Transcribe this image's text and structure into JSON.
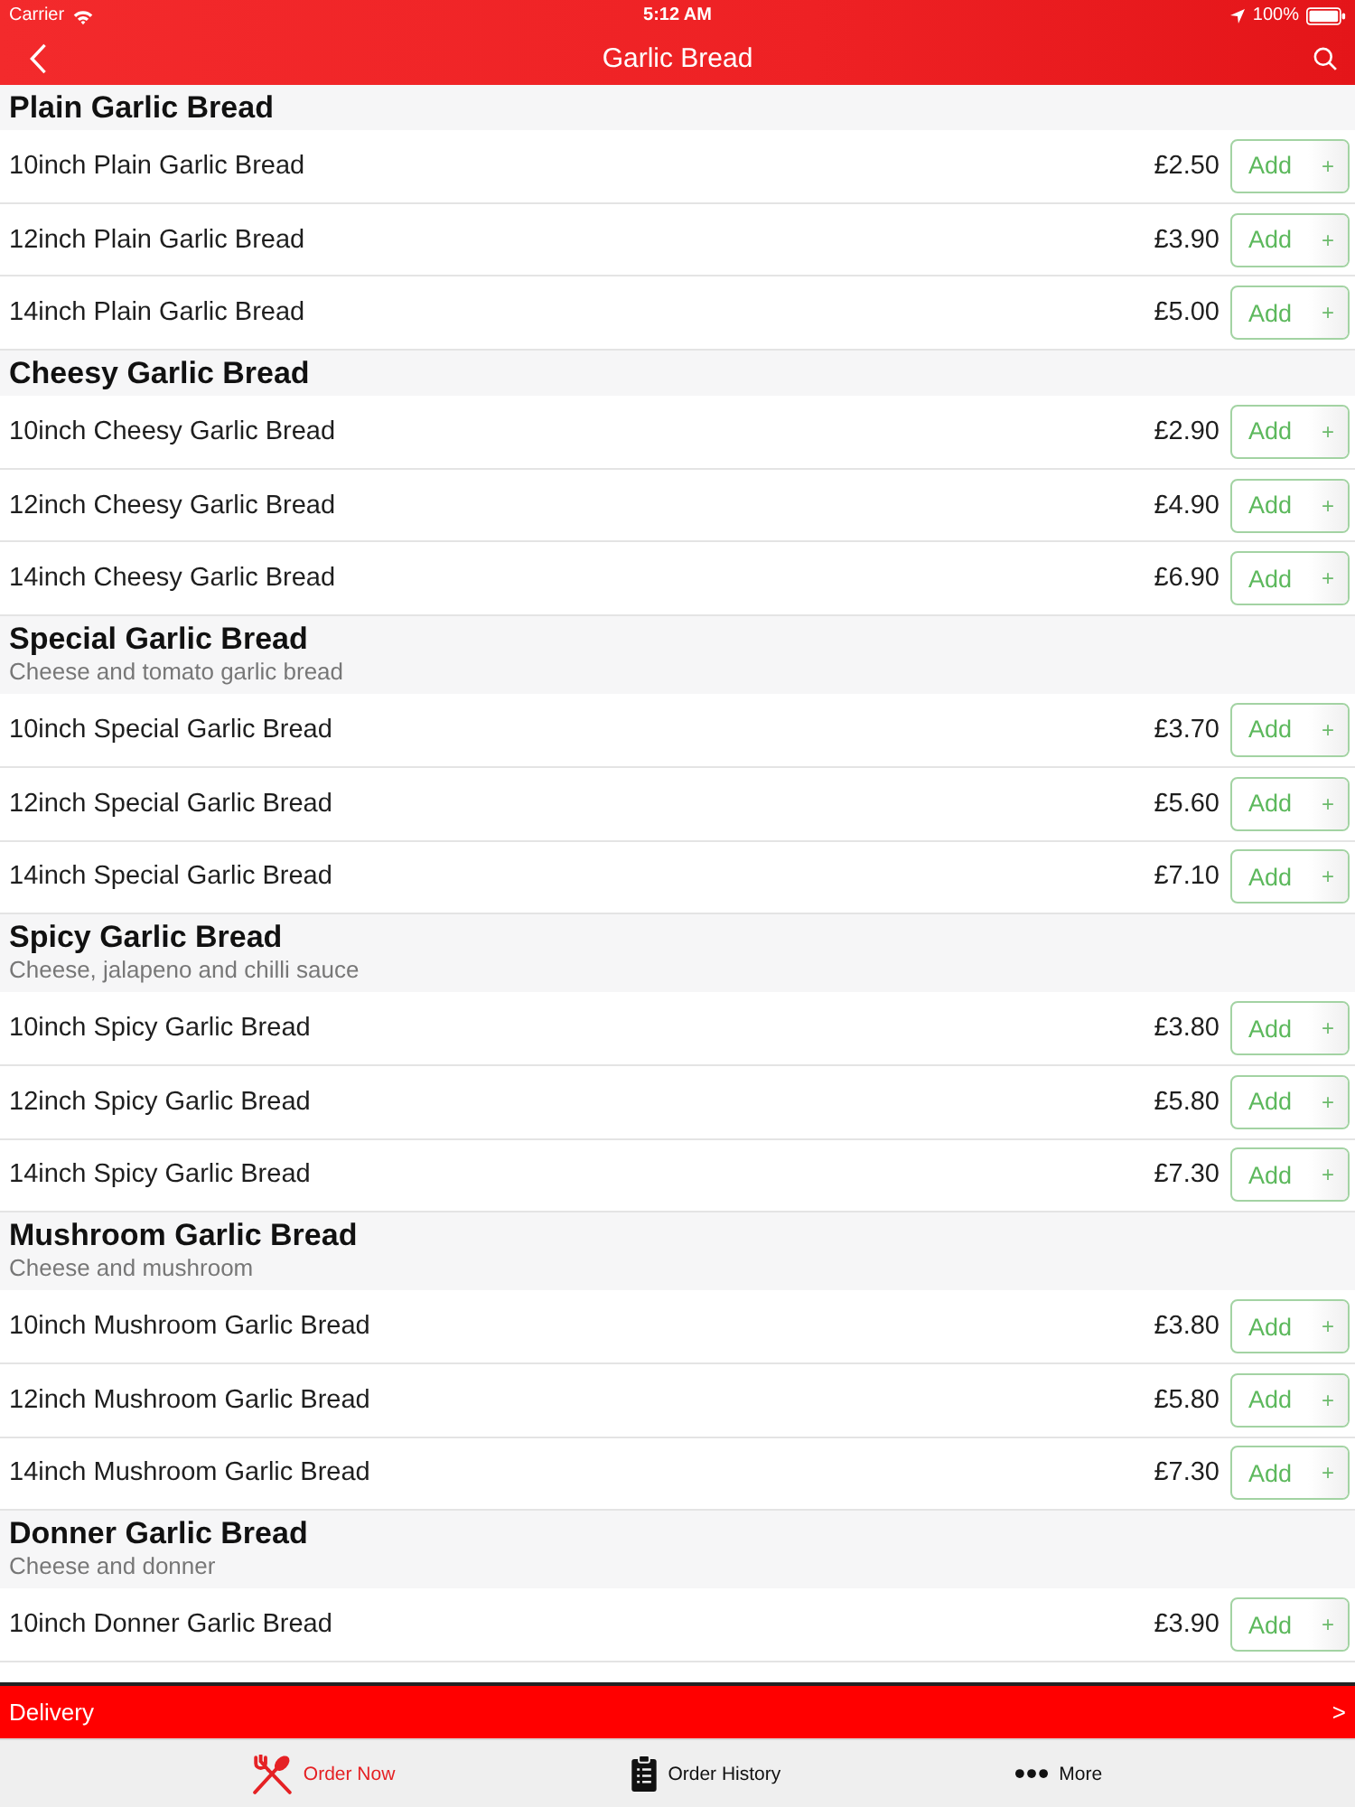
{
  "status_bar": {
    "carrier": "Carrier",
    "time": "5:12 AM",
    "battery": "100%"
  },
  "nav": {
    "title": "Garlic Bread"
  },
  "sections": [
    {
      "title": "Plain Garlic Bread",
      "items": [
        {
          "name": "10inch Plain Garlic Bread",
          "price": "£2.50",
          "button": "Add",
          "button_icon": "+"
        },
        {
          "name": "12inch Plain Garlic Bread",
          "price": "£3.90",
          "button": "Add",
          "button_icon": "+"
        },
        {
          "name": "14inch Plain Garlic Bread",
          "price": "£5.00",
          "button": "Add",
          "button_icon": "+"
        }
      ]
    },
    {
      "title": "Cheesy Garlic Bread",
      "items": [
        {
          "name": "10inch Cheesy Garlic Bread",
          "price": "£2.90",
          "button": "Add",
          "button_icon": "+"
        },
        {
          "name": "12inch Cheesy Garlic Bread",
          "price": "£4.90",
          "button": "Add",
          "button_icon": "+"
        },
        {
          "name": "14inch Cheesy Garlic Bread",
          "price": "£6.90",
          "button": "Add",
          "button_icon": "+"
        }
      ]
    },
    {
      "title": "Special Garlic Bread",
      "description": "Cheese and tomato garlic bread",
      "items": [
        {
          "name": "10inch Special Garlic Bread",
          "price": "£3.70",
          "button": "Add",
          "button_icon": "+"
        },
        {
          "name": "12inch Special Garlic Bread",
          "price": "£5.60",
          "button": "Add",
          "button_icon": "+"
        },
        {
          "name": "14inch Special Garlic Bread",
          "price": "£7.10",
          "button": "Add",
          "button_icon": "+"
        }
      ]
    },
    {
      "title": "Spicy Garlic Bread",
      "description": "Cheese, jalapeno and chilli sauce",
      "items": [
        {
          "name": "10inch Spicy Garlic Bread",
          "price": "£3.80",
          "button": "Add",
          "button_icon": "+"
        },
        {
          "name": "12inch Spicy Garlic Bread",
          "price": "£5.80",
          "button": "Add",
          "button_icon": "+"
        },
        {
          "name": "14inch Spicy Garlic Bread",
          "price": "£7.30",
          "button": "Add",
          "button_icon": "+"
        }
      ]
    },
    {
      "title": "Mushroom Garlic Bread",
      "description": "Cheese and mushroom",
      "items": [
        {
          "name": "10inch Mushroom Garlic Bread",
          "price": "£3.80",
          "button": "Add",
          "button_icon": "+"
        },
        {
          "name": "12inch Mushroom Garlic Bread",
          "price": "£5.80",
          "button": "Add",
          "button_icon": "+"
        },
        {
          "name": "14inch Mushroom Garlic Bread",
          "price": "£7.30",
          "button": "Add",
          "button_icon": "+"
        }
      ]
    },
    {
      "title": "Donner Garlic Bread",
      "description": "Cheese and donner",
      "items": [
        {
          "name": "10inch Donner Garlic Bread",
          "price": "£3.90",
          "button": "Add",
          "button_icon": "+"
        }
      ]
    }
  ],
  "delivery": {
    "label": "Delivery",
    "arrow": ">"
  },
  "tabs": [
    {
      "label": "Order Now",
      "selected": true
    },
    {
      "label": "Order History",
      "selected": false
    },
    {
      "label": "More",
      "selected": false
    }
  ]
}
